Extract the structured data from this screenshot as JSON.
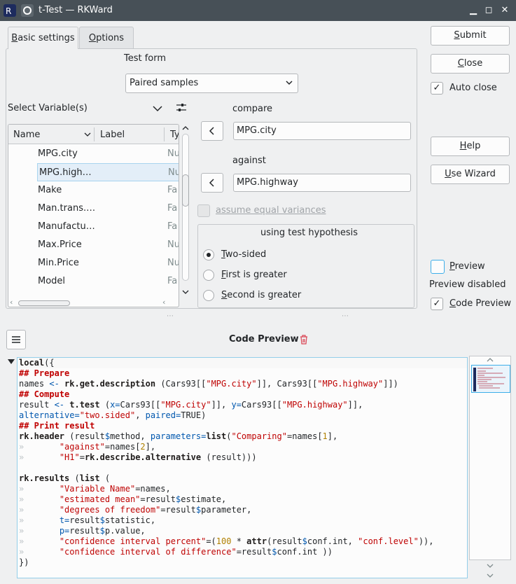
{
  "window": {
    "title": "t-Test — RKWard",
    "icon": "rkward-icon",
    "pin_icon": "pin-icon",
    "min_glyph": "▁",
    "max_glyph": "◻",
    "close_glyph": "✕"
  },
  "tabs": [
    {
      "label": "Basic settings",
      "underline": "B",
      "rest": "asic settings"
    },
    {
      "label": "Options",
      "underline": "O",
      "rest": "ptions"
    }
  ],
  "test_form": {
    "label": "Test form",
    "selected": "Paired samples"
  },
  "var_selector": {
    "label": "Select Variable(s)",
    "columns": [
      "Name",
      "Label",
      "Ty"
    ],
    "rows": [
      {
        "name": "MPG.city",
        "type": "Nu"
      },
      {
        "name": "MPG.high…",
        "type": "Nu"
      },
      {
        "name": "Make",
        "type": "Fa"
      },
      {
        "name": "Man.trans.…",
        "type": "Fa"
      },
      {
        "name": "Manufactu…",
        "type": "Fa"
      },
      {
        "name": "Max.Price",
        "type": "Nu"
      },
      {
        "name": "Min.Price",
        "type": "Nu"
      },
      {
        "name": "Model",
        "type": "Fa"
      }
    ]
  },
  "compare": {
    "label": "compare",
    "value": "MPG.city"
  },
  "against": {
    "label": "against",
    "value": "MPG.highway"
  },
  "equal_var": {
    "label": "assume equal variances"
  },
  "hypothesis": {
    "title": "using test hypothesis",
    "options": [
      {
        "u": "T",
        "rest": "wo-sided"
      },
      {
        "u": "F",
        "rest": "irst is greater"
      },
      {
        "u": "S",
        "rest": "econd is greater"
      }
    ]
  },
  "side_buttons": {
    "submit": {
      "u": "S",
      "rest": "ubmit"
    },
    "close": {
      "u": "C",
      "rest": "lose"
    },
    "auto_close": "Auto close",
    "help": {
      "u": "H",
      "rest": "elp"
    },
    "wizard": {
      "u": "U",
      "rest": "se Wizard"
    },
    "preview": {
      "u": "P",
      "rest": "review"
    },
    "preview_status": "Preview disabled",
    "code_preview": {
      "u": "C",
      "rest": "ode Preview"
    }
  },
  "code_preview": {
    "title": "Code Preview"
  },
  "code": {
    "l1a": "local",
    "l1b": "({",
    "l2": "## Prepare",
    "l3a": "names ",
    "l3b": "<-",
    "l3c": " rk.get.description",
    "l3d": " (Cars93[[",
    "l3e": "\"MPG.city\"",
    "l3f": "]], Cars93[[",
    "l3g": "\"MPG.highway\"",
    "l3h": "]])",
    "l4": "## Compute",
    "l5a": "result ",
    "l5b": "<-",
    "l5c": " t.test",
    "l5d": " (",
    "l5e": "x=",
    "l5f": "Cars93[[",
    "l5g": "\"MPG.city\"",
    "l5h": "]], ",
    "l5i": "y=",
    "l5j": "Cars93[[",
    "l5k": "\"MPG.highway\"",
    "l5l": "]],",
    "l6a": "alternative=",
    "l6b": "\"two.sided\"",
    "l6c": ", ",
    "l6d": "paired=",
    "l6e": "TRUE)",
    "l7": "## Print result",
    "l8a": "rk.header",
    "l8b": " (result",
    "l8c": "$",
    "l8d": "method, ",
    "l8e": "parameters=",
    "l8f": "list",
    "l8g": "(",
    "l8h": "\"Comparing\"",
    "l8i": "=names[",
    "l8j": "1",
    "l8k": "],",
    "tab": "»",
    "l9a": "\"against\"",
    "l9b": "=names[",
    "l9c": "2",
    "l9d": "],",
    "l10a": "\"H1\"",
    "l10b": "=",
    "l10c": "rk.describe.alternative",
    "l10d": " (result)))",
    "l12a": "rk.results",
    "l12b": " (",
    "l12c": "list",
    "l12d": " (",
    "l13a": "\"Variable Name\"",
    "l13b": "=names,",
    "l14a": "\"estimated mean\"",
    "l14b": "=result",
    "l14c": "$",
    "l14d": "estimate,",
    "l15a": "\"degrees of freedom\"",
    "l15b": "=result",
    "l15c": "$",
    "l15d": "parameter,",
    "l16a": "t=",
    "l16b": "result",
    "l16c": "$",
    "l16d": "statistic,",
    "l17a": "p=",
    "l17b": "result",
    "l17c": "$",
    "l17d": "p.value,",
    "l18a": "\"confidence interval percent\"",
    "l18b": "=(",
    "l18c": "100",
    "l18d": " * ",
    "l18e": "attr",
    "l18f": "(result",
    "l18g": "$",
    "l18h": "conf.int, ",
    "l18i": "\"conf.level\"",
    "l18j": ")),",
    "l19a": "\"confidence interval of difference\"",
    "l19b": "=result",
    "l19c": "$",
    "l19d": "conf.int ))",
    "l20": "})"
  },
  "colors": {
    "accent": "#3daee9",
    "titlebar": "#475057",
    "selection": "#e3eef8"
  }
}
